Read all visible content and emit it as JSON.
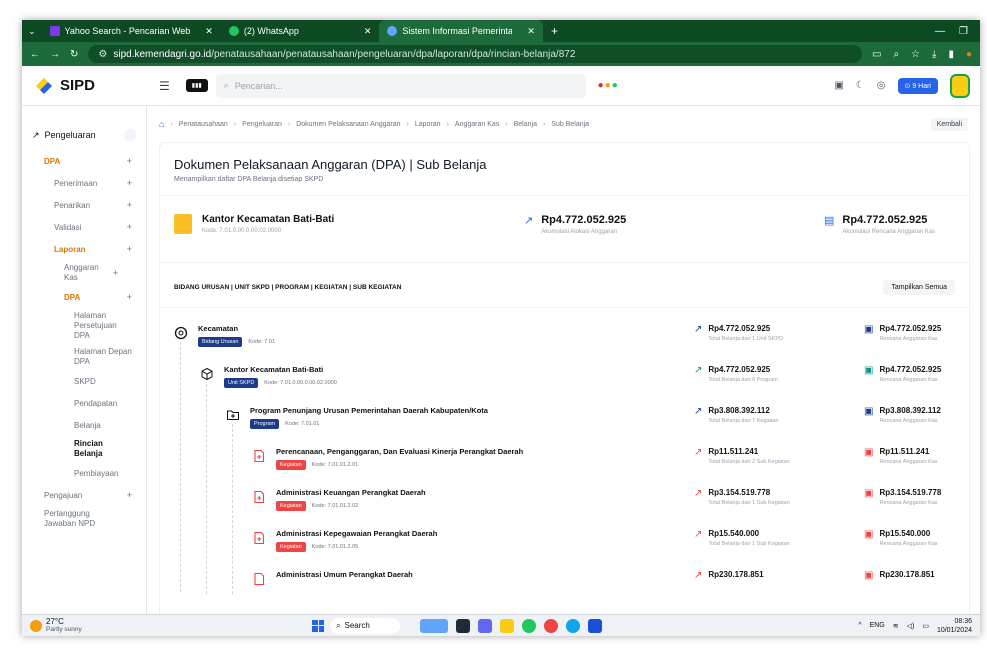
{
  "browser": {
    "tabs": [
      {
        "label": "Yahoo Search - Pencarian Web",
        "color": "#7c3aed"
      },
      {
        "label": "(2) WhatsApp",
        "color": "#22c55e"
      },
      {
        "label": "Sistem Informasi Pemerintahan",
        "color": "#60a5fa",
        "active": true
      }
    ],
    "url_domain": "sipd.kemendagri.go.id",
    "url_path": "/penatausahaan/penatausahaan/pengeluaran/dpa/laporan/dpa/rincian-belanja/872"
  },
  "header": {
    "brand": "SIPD",
    "search_placeholder": "Pencarian...",
    "days_badge": "9 Hari"
  },
  "sidebar": {
    "group": "Pengeluaran",
    "items": [
      {
        "label": "DPA",
        "level": 1,
        "state": "active"
      },
      {
        "label": "Penerimaan",
        "level": 2
      },
      {
        "label": "Penarikan",
        "level": 2
      },
      {
        "label": "Validasi",
        "level": 2
      },
      {
        "label": "Laporan",
        "level": 2,
        "state": "active"
      },
      {
        "label": "Anggaran Kas",
        "level": 3
      },
      {
        "label": "DPA",
        "level": 3,
        "state": "active"
      },
      {
        "label": "Halaman Persetujuan DPA",
        "level": 4
      },
      {
        "label": "Halaman Depan DPA",
        "level": 4
      },
      {
        "label": "SKPD",
        "level": 4
      },
      {
        "label": "Pendapatan",
        "level": 4
      },
      {
        "label": "Belanja",
        "level": 4
      },
      {
        "label": "Rincian Belanja",
        "level": 4,
        "state": "current"
      },
      {
        "label": "Pembiayaan",
        "level": 4
      },
      {
        "label": "Pengajuan",
        "level": 1
      },
      {
        "label": "Pertanggung Jawaban NPD",
        "level": 1
      }
    ]
  },
  "breadcrumb": [
    "Penatausahaan",
    "Pengeluaran",
    "Dokumen Pelaksanaan Anggaran",
    "Laporan",
    "Anggaran Kas",
    "Belanja",
    "Sub Belanja"
  ],
  "back_label": "Kembali",
  "page": {
    "title": "Dokumen Pelaksanaan Anggaran (DPA) | Sub Belanja",
    "subtitle": "Menampilkan daftar DPA Belanja disetiap SKPD"
  },
  "summary": {
    "unit_name": "Kantor Kecamatan Bati-Bati",
    "unit_code": "Kode: 7.01.0.00.0.00.02.0000",
    "alokasi_value": "Rp4.772.052.925",
    "alokasi_caption": "Akumulasi Alokasi Anggaran",
    "rencana_value": "Rp4.772.052.925",
    "rencana_caption": "Akumulasi Rencana Anggaran Kas"
  },
  "section": {
    "title": "BIDANG URUSAN | UNIT SKPD | PROGRAM | KEGIATAN | SUB KEGIATAN",
    "show_all": "Tampilkan Semua"
  },
  "rows": [
    {
      "level": 0,
      "icon": "aperture",
      "name": "Kecamatan",
      "tag": "Bidang Urusan",
      "tag_color": "navy",
      "kode": "Kode: 7.01",
      "total": "Rp4.772.052.925",
      "total_caption": "Total Belanja dari 1 Unit SKPD",
      "rencana": "Rp4.772.052.925",
      "rencana_caption": "Rencana Anggaran Kas"
    },
    {
      "level": 1,
      "icon": "cube",
      "name": "Kantor Kecamatan Bati-Bati",
      "tag": "Unit SKPD",
      "tag_color": "navy",
      "kode": "Kode: 7.01.0.00.0.00.02.0000",
      "total": "Rp4.772.052.925",
      "total_caption": "Total Belanja dari 8 Program",
      "rencana": "Rp4.772.052.925",
      "rencana_caption": "Rencana Anggaran Kas"
    },
    {
      "level": 2,
      "icon": "folder-plus",
      "name": "Program Penunjang Urusan Pemerintahan Daerah Kabupaten/Kota",
      "tag": "Program",
      "tag_color": "navy",
      "kode": "Kode: 7.01.01",
      "total": "Rp3.808.392.112",
      "total_caption": "Total Belanja dari 7 Kegiatan",
      "rencana": "Rp3.808.392.112",
      "rencana_caption": "Rencana Anggaran Kas"
    },
    {
      "level": 3,
      "icon": "file-plus",
      "name": "Perencanaan, Penganggaran, Dan Evaluasi Kinerja Perangkat Daerah",
      "tag": "Kegiatan",
      "tag_color": "red",
      "kode": "Kode: 7.01.01.2.01",
      "total": "Rp11.511.241",
      "total_caption": "Total Belanja dari 2 Sub Kegiatan",
      "rencana": "Rp11.511.241",
      "rencana_caption": "Rencana Anggaran Kas"
    },
    {
      "level": 3,
      "icon": "file-plus",
      "name": "Administrasi Keuangan Perangkat Daerah",
      "tag": "Kegiatan",
      "tag_color": "red",
      "kode": "Kode: 7.01.01.2.02",
      "total": "Rp3.154.519.778",
      "total_caption": "Total Belanja dari 1 Sub Kegiatan",
      "rencana": "Rp3.154.519.778",
      "rencana_caption": "Rencana Anggaran Kas"
    },
    {
      "level": 3,
      "icon": "file-plus",
      "name": "Administrasi Kepegawaian Perangkat Daerah",
      "tag": "Kegiatan",
      "tag_color": "red",
      "kode": "Kode: 7.01.01.2.05",
      "total": "Rp15.540.000",
      "total_caption": "Total Belanja dari 1 Sub Kegiatan",
      "rencana": "Rp15.540.000",
      "rencana_caption": "Rencana Anggaran Kas"
    },
    {
      "level": 3,
      "icon": "file-plus",
      "name": "Administrasi Umum Perangkat Daerah",
      "tag": "",
      "tag_color": "red",
      "kode": "",
      "total": "Rp230.178.851",
      "total_caption": "",
      "rencana": "Rp230.178.851",
      "rencana_caption": ""
    }
  ],
  "taskbar": {
    "temp": "27°C",
    "weather": "Partly sunny",
    "search": "Search",
    "lang": "ENG",
    "time": "08:36",
    "date": "10/01/2024"
  }
}
